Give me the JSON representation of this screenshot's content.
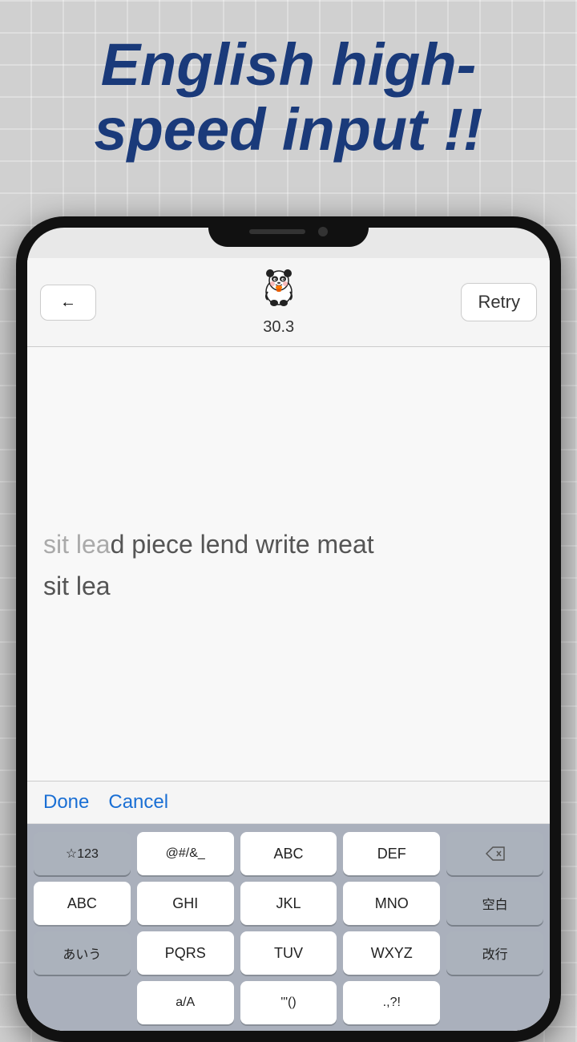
{
  "headline": {
    "line1": "English high-",
    "line2": "speed input !!"
  },
  "topbar": {
    "back_label": "←",
    "score": "30.3",
    "retry_label": "Retry"
  },
  "textdisplay": {
    "target_typed": "sit lea",
    "target_remaining": "d piece lend write meat",
    "current_input": "sit lea"
  },
  "actionbar": {
    "done_label": "Done",
    "cancel_label": "Cancel"
  },
  "keyboard": {
    "row1": [
      "☆123",
      "@#/&_",
      "ABC",
      "DEF",
      "⌫"
    ],
    "row2": [
      "ABC",
      "GHI",
      "JKL",
      "MNO",
      "空白"
    ],
    "row3_left": "あいう",
    "row3_mid": [
      "PQRS",
      "TUV",
      "WXYZ"
    ],
    "row3_right": "改行",
    "row4_mid": [
      "a/A",
      "'\"()",
      ".,?!"
    ]
  },
  "panda": {
    "emoji": "🐼"
  }
}
